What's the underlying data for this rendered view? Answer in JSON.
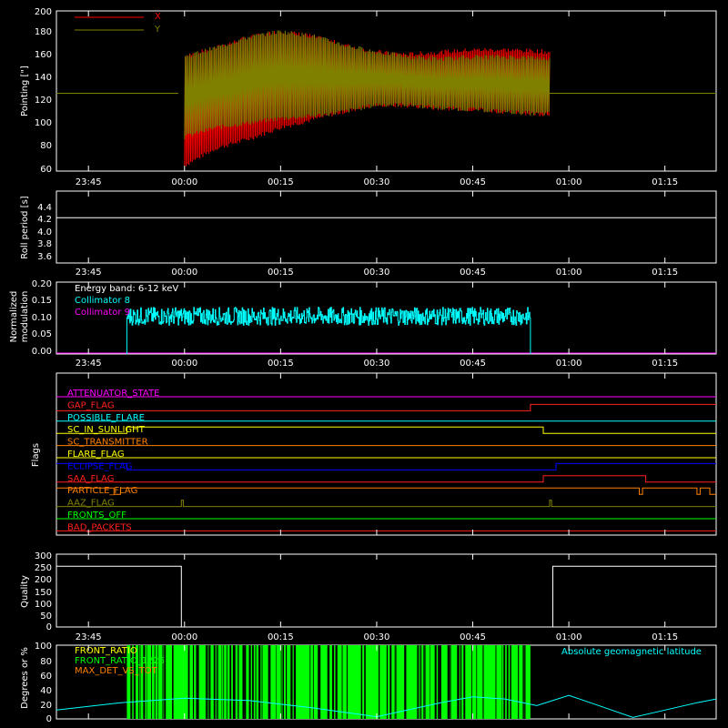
{
  "time_ticks": [
    "23:45",
    "00:00",
    "00:15",
    "00:30",
    "00:45",
    "01:00",
    "01:15"
  ],
  "panels": {
    "pointing": {
      "ylabel": "Pointing [\"]",
      "ylim": [
        60,
        200
      ],
      "yticks": [
        "200",
        "180",
        "160",
        "140",
        "120",
        "100",
        "80",
        "60"
      ],
      "legend": [
        {
          "label": "X",
          "color": "#ff0000"
        },
        {
          "label": "Y",
          "color": "#808000"
        }
      ]
    },
    "roll": {
      "ylabel": "Roll period [s]",
      "ylim": [
        3.5,
        4.5
      ],
      "yticks": [
        "4.4",
        "4.2",
        "4.0",
        "3.8",
        "3.6"
      ],
      "value": 4.13
    },
    "modulation": {
      "ylabel_1": "Normalized",
      "ylabel_2": "modulation",
      "ylim": [
        0,
        0.2
      ],
      "yticks": [
        "0.20",
        "0.15",
        "0.10",
        "0.05",
        "0.00"
      ],
      "energy_band": "Energy band: 6-12 keV",
      "legend": [
        {
          "label": "Collimator 8",
          "color": "#00ffff"
        },
        {
          "label": "Collimator 9",
          "color": "#ff00ff"
        }
      ]
    },
    "flags": {
      "ylabel": "Flags",
      "items": [
        {
          "label": "ATTENUATOR_STATE",
          "color": "#ff00ff"
        },
        {
          "label": "GAP_FLAG",
          "color": "#ff2020"
        },
        {
          "label": "POSSIBLE_FLARE",
          "color": "#00ffff"
        },
        {
          "label": "SC_IN_SUNLIGHT",
          "color": "#ffff00"
        },
        {
          "label": "SC_TRANSMITTER",
          "color": "#ff8000"
        },
        {
          "label": "FLARE_FLAG",
          "color": "#ffff00"
        },
        {
          "label": "ECLIPSE_FLAG",
          "color": "#0000ff"
        },
        {
          "label": "SAA_FLAG",
          "color": "#ff2020"
        },
        {
          "label": "PARTICLE_FLAG",
          "color": "#ff8000"
        },
        {
          "label": "AAZ_FLAG",
          "color": "#808000"
        },
        {
          "label": "FRONTS_OFF",
          "color": "#00ff00"
        },
        {
          "label": "BAD_PACKETS",
          "color": "#ff2020"
        }
      ]
    },
    "quality": {
      "ylabel": "Quality",
      "ylim": [
        0,
        300
      ],
      "yticks": [
        "300",
        "250",
        "200",
        "150",
        "100",
        "50",
        "0"
      ]
    },
    "ratios": {
      "ylabel": "Degrees or %",
      "ylim": [
        0,
        100
      ],
      "yticks": [
        "100",
        "80",
        "60",
        "40",
        "20",
        "0"
      ],
      "legend": [
        {
          "label": "FRONT_RATIO",
          "color": "#ffff00"
        },
        {
          "label": "FRONT_RATIO_1225",
          "color": "#00ff00"
        },
        {
          "label": "MAX_DET_VS_TOT",
          "color": "#ff8000"
        }
      ],
      "latitude_label": "Absolute geomagnetic latitude",
      "latitude_color": "#00ffff"
    }
  },
  "chart_data": {
    "type": "line",
    "title": "",
    "time_range": [
      "23:40",
      "01:23"
    ],
    "panels": [
      {
        "name": "pointing",
        "series": [
          {
            "name": "X",
            "color": "#ff0000",
            "x": [
              "23:40",
              "23:59",
              "00:00",
              "00:05",
              "00:10",
              "00:15",
              "00:20",
              "00:25",
              "00:30",
              "00:35",
              "00:40",
              "00:45",
              "00:50",
              "00:55",
              "00:57",
              "01:23"
            ],
            "upper": [
              128,
              128,
              160,
              168,
              177,
              182,
              178,
              170,
              164,
              162,
              164,
              166,
              166,
              165,
              164,
              128
            ],
            "lower": [
              128,
              128,
              65,
              80,
              88,
              98,
              105,
              112,
              118,
              117,
              115,
              114,
              112,
              110,
              110,
              128
            ]
          },
          {
            "name": "Y",
            "color": "#808000",
            "x": [
              "23:40",
              "23:59",
              "00:00",
              "00:05",
              "00:10",
              "00:15",
              "00:20",
              "00:25",
              "00:30",
              "00:35",
              "00:40",
              "00:45",
              "00:50",
              "00:55",
              "00:57",
              "01:23"
            ],
            "upper": [
              128,
              128,
              160,
              168,
              177,
              182,
              178,
              170,
              164,
              160,
              158,
              160,
              160,
              159,
              158,
              128
            ],
            "lower": [
              128,
              128,
              90,
              98,
              102,
              106,
              108,
              112,
              118,
              118,
              115,
              114,
              112,
              110,
              110,
              128
            ]
          }
        ]
      },
      {
        "name": "roll_period",
        "series": [
          {
            "x": [
              "23:40",
              "01:23"
            ],
            "y": [
              4.13,
              4.13
            ]
          }
        ]
      },
      {
        "name": "modulation",
        "series": [
          {
            "name": "Collimator 8",
            "x_start": "23:51",
            "x_end": "00:54",
            "y_mean": 0.1,
            "y_min": 0.08,
            "y_max": 0.13
          },
          {
            "name": "Collimator 9",
            "x": [
              "23:40",
              "01:23"
            ],
            "y": [
              0.0,
              0.0
            ]
          }
        ]
      },
      {
        "name": "flags",
        "series": [
          {
            "name": "ATTENUATOR_STATE",
            "steps": [
              [
                "23:40",
                0
              ]
            ]
          },
          {
            "name": "GAP_FLAG",
            "steps": [
              [
                "23:40",
                0
              ],
              [
                "00:54",
                1
              ]
            ]
          },
          {
            "name": "POSSIBLE_FLARE",
            "steps": [
              [
                "23:40",
                0
              ]
            ]
          },
          {
            "name": "SC_IN_SUNLIGHT",
            "steps": [
              [
                "23:40",
                0
              ],
              [
                "23:51",
                1
              ],
              [
                "00:56",
                0
              ]
            ]
          },
          {
            "name": "SC_TRANSMITTER",
            "steps": [
              [
                "23:40",
                0
              ]
            ]
          },
          {
            "name": "FLARE_FLAG",
            "steps": [
              [
                "23:40",
                0
              ]
            ]
          },
          {
            "name": "ECLIPSE_FLAG",
            "steps": [
              [
                "23:40",
                1
              ],
              [
                "23:51",
                0
              ],
              [
                "00:58",
                1
              ]
            ]
          },
          {
            "name": "SAA_FLAG",
            "steps": [
              [
                "23:40",
                0
              ],
              [
                "00:56",
                1
              ],
              [
                "01:12",
                0
              ]
            ]
          },
          {
            "name": "PARTICLE_FLAG",
            "steps": [
              [
                "23:40",
                1
              ],
              [
                "23:49",
                0
              ],
              [
                "23:50",
                1
              ],
              [
                "01:11",
                0
              ],
              [
                "01:11.5",
                1
              ],
              [
                "01:20",
                0
              ],
              [
                "01:20.5",
                1
              ],
              [
                "01:22",
                0
              ]
            ]
          },
          {
            "name": "AAZ_FLAG",
            "steps": [
              [
                "23:40",
                0
              ],
              [
                "23:59.5",
                1
              ],
              [
                "23:59.8",
                0
              ],
              [
                "00:57",
                1
              ],
              [
                "00:57.3",
                0
              ]
            ]
          },
          {
            "name": "FRONTS_OFF",
            "steps": [
              [
                "23:40",
                0
              ]
            ]
          },
          {
            "name": "BAD_PACKETS",
            "steps": [
              [
                "23:40",
                0
              ]
            ]
          }
        ]
      },
      {
        "name": "quality",
        "series": [
          {
            "x": [
              "23:40",
              "23:59.5",
              "23:59.5",
              "00:57.5",
              "00:57.5",
              "01:23"
            ],
            "y": [
              250,
              250,
              0,
              0,
              250,
              250
            ]
          }
        ]
      },
      {
        "name": "ratios",
        "series": [
          {
            "name": "FRONT_RATIO_1225",
            "x_start": "23:51",
            "x_end": "00:54",
            "y": 100
          },
          {
            "name": "Absolute geomagnetic latitude",
            "x": [
              "23:40",
              "23:50",
              "00:00",
              "00:10",
              "00:20",
              "00:30",
              "00:40",
              "00:45",
              "00:50",
              "00:55",
              "01:00",
              "01:05",
              "01:10",
              "01:15",
              "01:20",
              "01:23"
            ],
            "y": [
              12,
              22,
              28,
              25,
              15,
              3,
              22,
              30,
              27,
              18,
              32,
              17,
              2,
              12,
              22,
              27
            ]
          }
        ]
      }
    ]
  }
}
